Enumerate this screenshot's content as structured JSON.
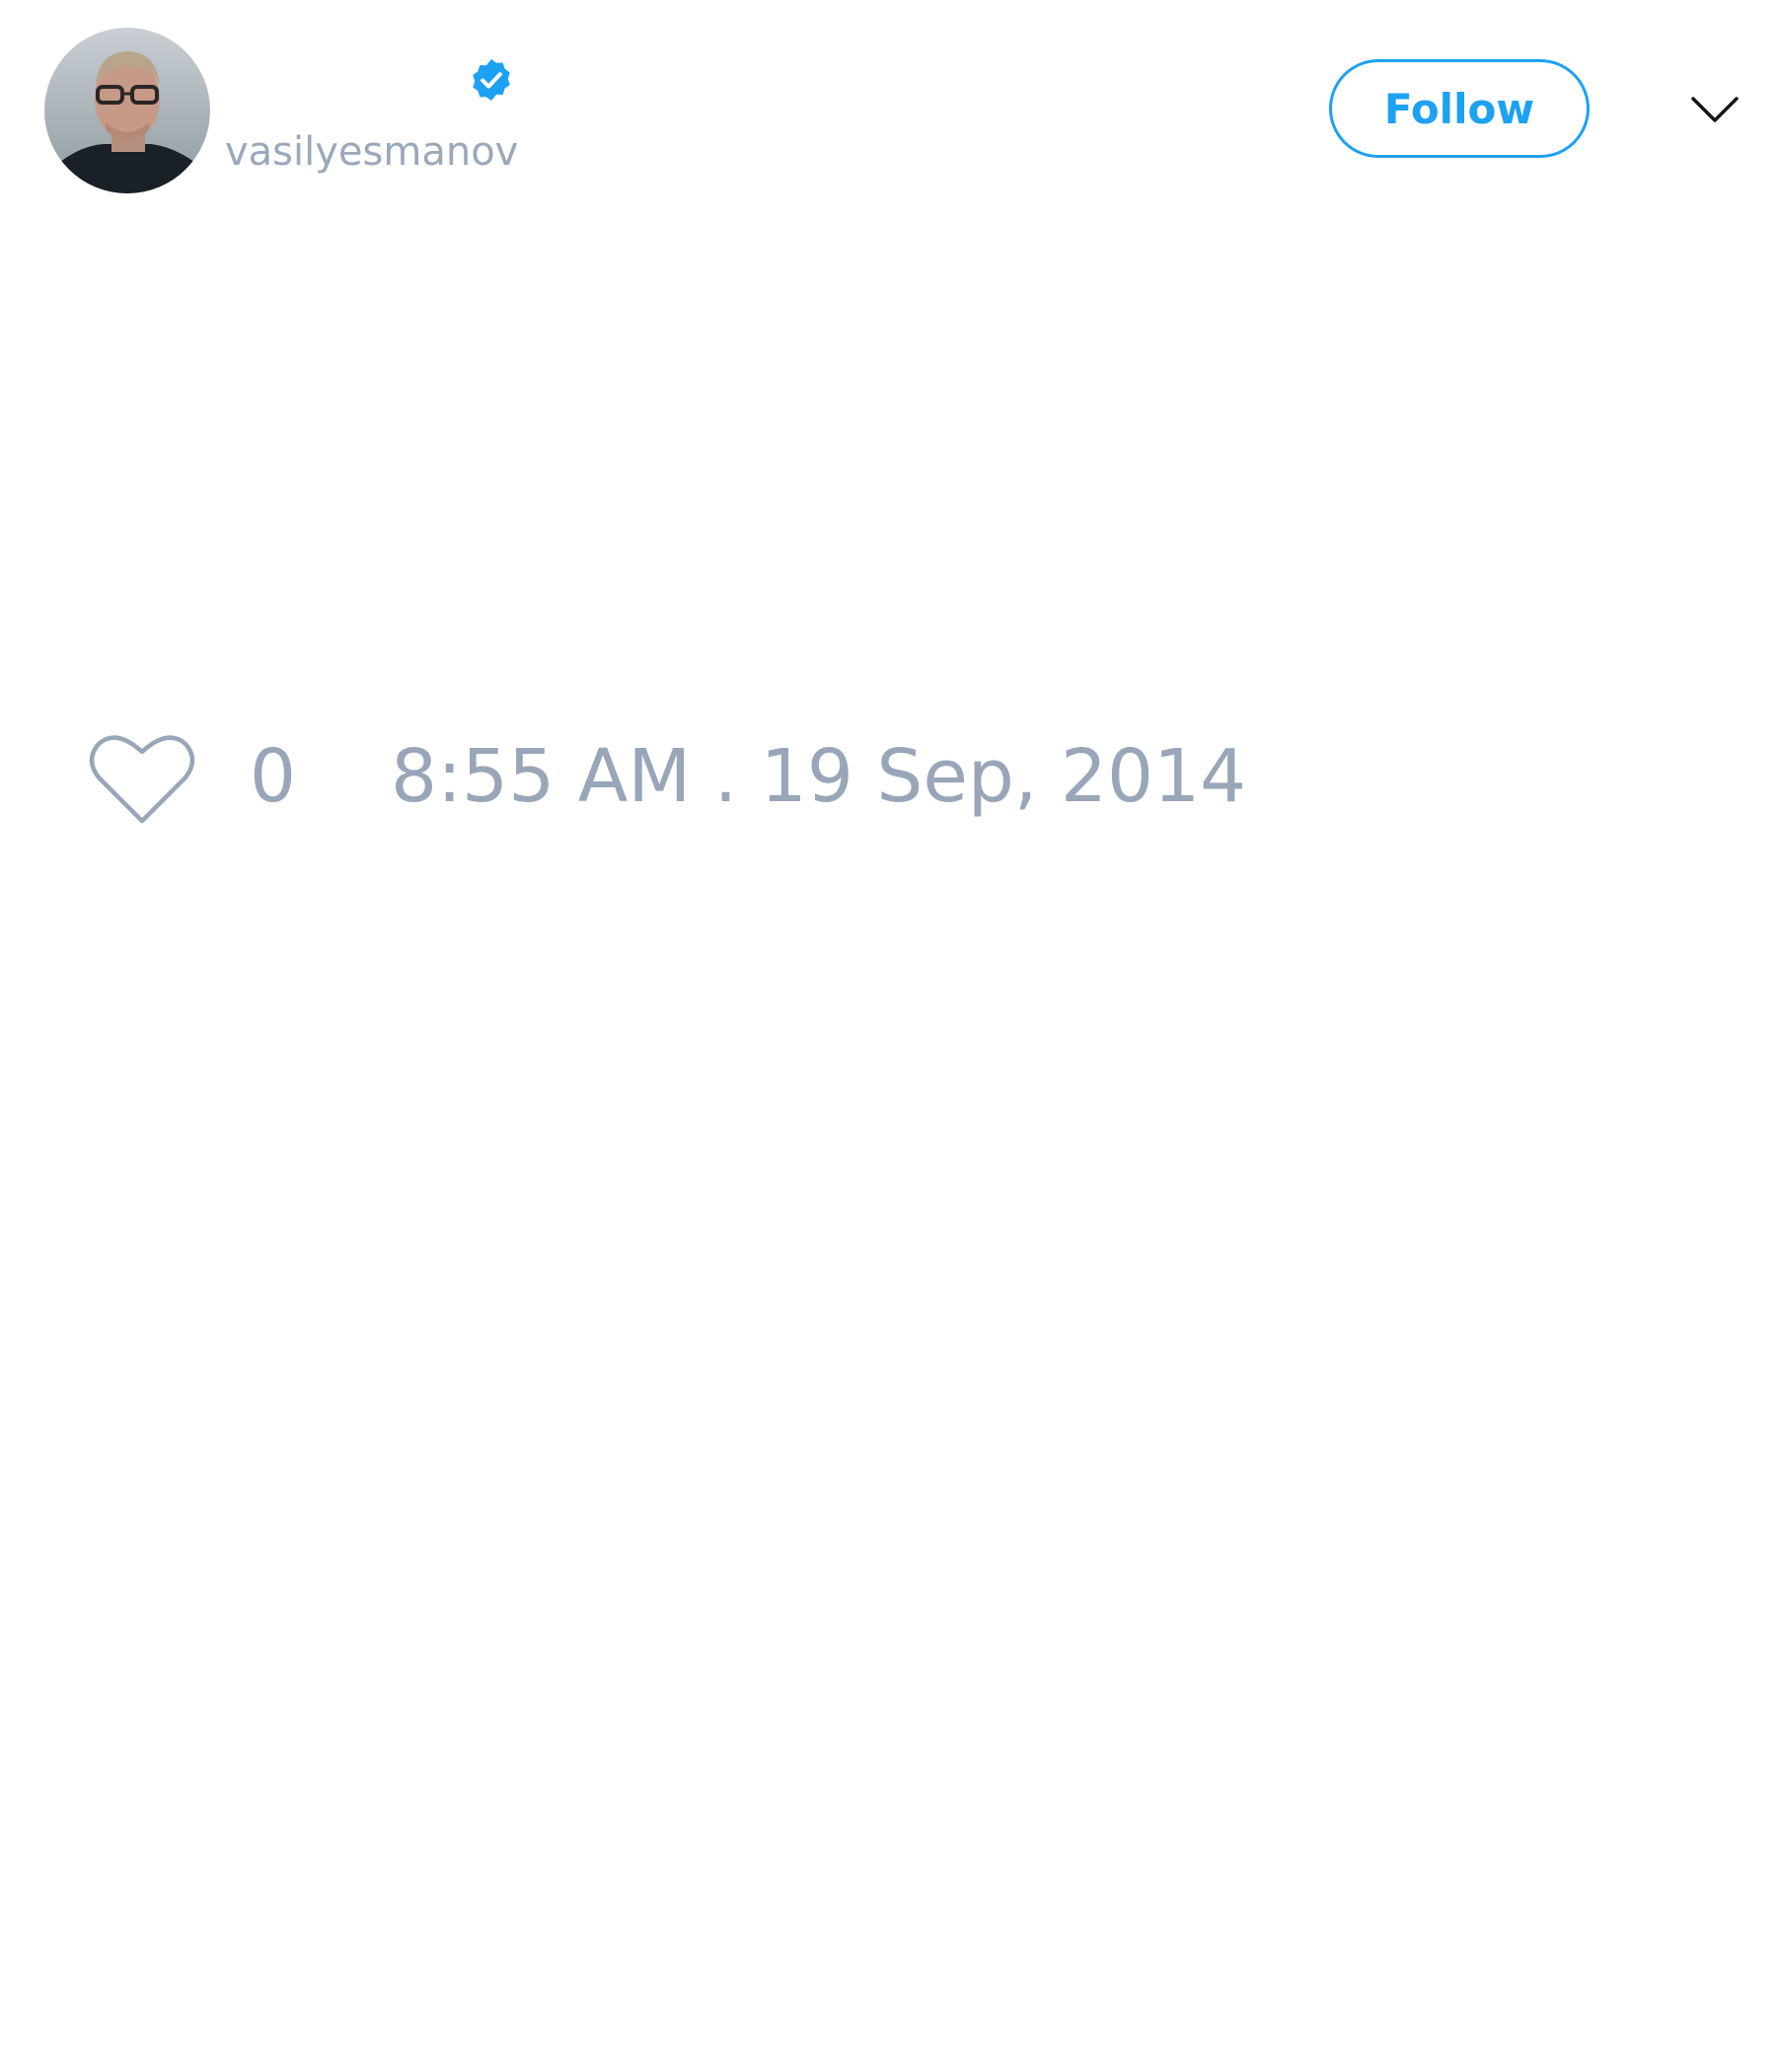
{
  "tweet": {
    "author": {
      "username": "vasilyesmanov",
      "verified": true,
      "avatar_icon": "user-avatar-photo",
      "verified_icon": "verified-badge-icon"
    },
    "actions": {
      "follow_label": "Follow",
      "more_icon": "chevron-down-icon"
    },
    "stats": {
      "like_icon": "heart-outline-icon",
      "like_count": "0",
      "timestamp": "8:55 AM . 19 Sep, 2014"
    }
  },
  "colors": {
    "accent": "#1da1f2",
    "muted_text": "#98a6b8",
    "background": "#ffffff"
  }
}
